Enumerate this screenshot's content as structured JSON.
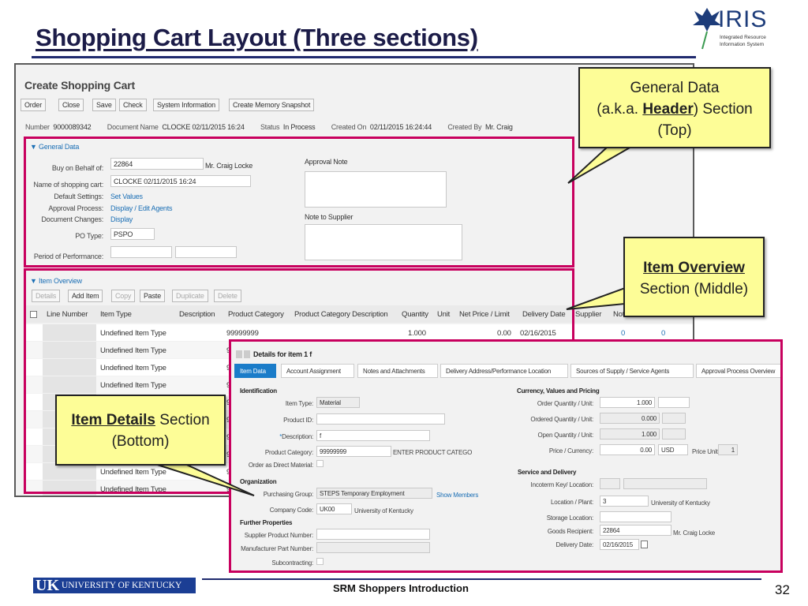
{
  "slide": {
    "title": "Shopping Cart Layout (Three sections)",
    "footer": "SRM Shoppers Introduction",
    "page_number": "32",
    "footer_logo": "UNIVERSITY OF KENTUCKY",
    "logo_text": "IRIS",
    "logo_sub1": "Integrated Resource",
    "logo_sub2": "Information System",
    "accent_color": "#c8005e",
    "callout_color": "#fdfd97"
  },
  "app": {
    "title": "Create Shopping Cart",
    "toolbar": [
      "Order",
      "Close",
      "Save",
      "Check",
      "System Information",
      "Create Memory Snapshot"
    ],
    "header": {
      "number_label": "Number",
      "number": "9000089342",
      "docname_label": "Document Name",
      "docname": "CLOCKE 02/11/2015 16:24",
      "status_label": "Status",
      "status": "In Process",
      "created_on_label": "Created On",
      "created_on": "02/11/2015 16:24:44",
      "created_by_label": "Created By",
      "created_by": "Mr. Craig"
    },
    "general": {
      "section": "General Data",
      "buy_label": "Buy on Behalf of:",
      "buy_value": "22864",
      "buy_name": "Mr. Craig Locke",
      "name_label": "Name of shopping cart:",
      "name_value": "CLOCKE 02/11/2015 16:24",
      "default_label": "Default Settings:",
      "default_link": "Set Values",
      "approval_label": "Approval Process:",
      "approval_link": "Display / Edit Agents",
      "changes_label": "Document Changes:",
      "changes_link": "Display",
      "po_label": "PO Type:",
      "po_value": "PSPO",
      "period_label": "Period of Performance:",
      "approval_note": "Approval Note",
      "supplier_note": "Note to Supplier"
    },
    "items": {
      "section": "Item Overview",
      "buttons": [
        "Details",
        "Add Item",
        "Copy",
        "Paste",
        "Duplicate",
        "Delete"
      ],
      "columns": [
        "Line Number",
        "Item Type",
        "Description",
        "Product Category",
        "Product Category Description",
        "Quantity",
        "Unit",
        "Net Price / Limit",
        "Delivery Date",
        "Supplier",
        "Not"
      ],
      "first_row": {
        "type": "Undefined Item Type",
        "category": "99999999",
        "quantity": "1.000",
        "price": "0.00",
        "date": "02/16/2015",
        "c1": "0",
        "c2": "0"
      },
      "row_type": "Undefined Item Type",
      "row_partial": "9"
    },
    "details": {
      "title": "Details for item 1  f",
      "tabs": [
        "Item Data",
        "Account Assignment",
        "Notes and Attachments",
        "Delivery Address/Performance Location",
        "Sources of Supply / Service Agents",
        "Approval Process Overview"
      ],
      "identification": "Identification",
      "item_type_label": "Item Type:",
      "item_type": "Material",
      "product_id_label": "Product ID:",
      "desc_label": "Description:",
      "desc": "f",
      "cat_label": "Product Category:",
      "cat": "99999999",
      "cat_desc": "ENTER PRODUCT CATEGO",
      "direct_label": "Order as Direct Material:",
      "organization": "Organization",
      "pgroup_label": "Purchasing Group:",
      "pgroup": "STEPS Temporary Employment",
      "show_members": "Show Members",
      "ccode_label": "Company Code:",
      "ccode": "UK00",
      "ccode_name": "University of Kentucky",
      "further": "Further Properties",
      "spn_label": "Supplier Product Number:",
      "mpn_label": "Manufacturer Part Number:",
      "subc_label": "Subcontracting:",
      "currency": "Currency, Values and Pricing",
      "oq_label": "Order Quantity / Unit:",
      "oq": "1.000",
      "ordq_label": "Ordered Quantity / Unit:",
      "ordq": "0.000",
      "openq_label": "Open Quantity / Unit:",
      "openq": "1.000",
      "price_label": "Price / Currency:",
      "price": "0.00",
      "cur": "USD",
      "punit_label": "Price Unit",
      "punit": "1",
      "service": "Service and Delivery",
      "inco_label": "Incoterm Key/ Location:",
      "loc_label": "Location / Plant:",
      "loc": "3",
      "loc_name": "University of Kentucky",
      "stor_label": "Storage Location:",
      "gr_label": "Goods Recipient:",
      "gr": "22864",
      "gr_name": "Mr. Craig Locke",
      "dd_label": "Delivery Date:",
      "dd": "02/16/2015"
    }
  },
  "callouts": {
    "top_l1": "General Data",
    "top_l2a": "(a.k.a. ",
    "top_l2b": "Header",
    "top_l2c": ") Section",
    "top_l3": "(Top)",
    "mid_l1": "Item Overview",
    "mid_l2": "Section (Middle)",
    "bot_l1a": "Item Details",
    "bot_l1b": " Section",
    "bot_l2": "(Bottom)"
  }
}
